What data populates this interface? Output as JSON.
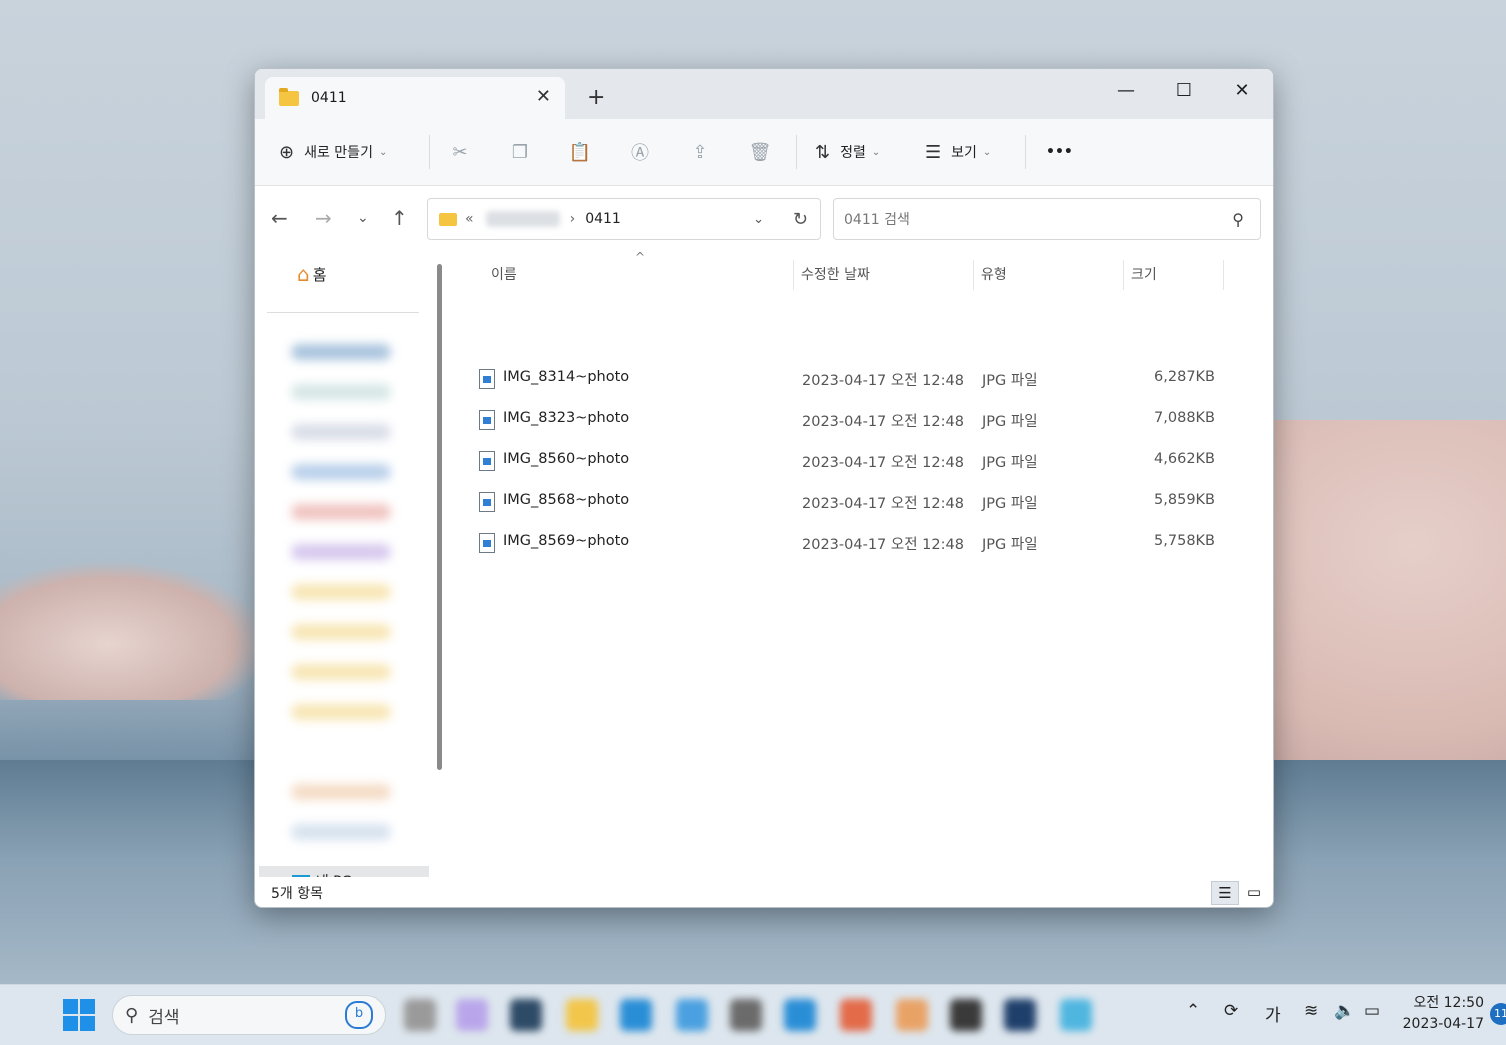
{
  "window": {
    "tab_title": "0411",
    "close_tab": "✕",
    "new_tab": "+",
    "minimize": "—",
    "maximize": "☐",
    "close": "✕"
  },
  "commandbar": {
    "new_label": "새로 만들기",
    "sort_label": "정렬",
    "view_label": "보기",
    "more": "•••"
  },
  "nav": {
    "address_sep": "«",
    "address_arrow": "›",
    "current_folder": "0411",
    "search_placeholder": "0411 검색"
  },
  "sidebar": {
    "home_label": "홈",
    "pc_label": "내 PC"
  },
  "columns": {
    "name": "이름",
    "date": "수정한 날짜",
    "type": "유형",
    "size": "크기"
  },
  "files": [
    {
      "name": "IMG_8314~photo",
      "date": "2023-04-17 오전 12:48",
      "type": "JPG 파일",
      "size": "6,287KB"
    },
    {
      "name": "IMG_8323~photo",
      "date": "2023-04-17 오전 12:48",
      "type": "JPG 파일",
      "size": "7,088KB"
    },
    {
      "name": "IMG_8560~photo",
      "date": "2023-04-17 오전 12:48",
      "type": "JPG 파일",
      "size": "4,662KB"
    },
    {
      "name": "IMG_8568~photo",
      "date": "2023-04-17 오전 12:48",
      "type": "JPG 파일",
      "size": "5,859KB"
    },
    {
      "name": "IMG_8569~photo",
      "date": "2023-04-17 오전 12:48",
      "type": "JPG 파일",
      "size": "5,758KB"
    }
  ],
  "status": {
    "item_count": "5개 항목"
  },
  "taskbar": {
    "search_label": "검색",
    "ime": "가",
    "time": "오전 12:50",
    "date": "2023-04-17",
    "notification_count": "11"
  },
  "colors": {
    "accent": "#1e90e8",
    "folder": "#f5c542"
  }
}
